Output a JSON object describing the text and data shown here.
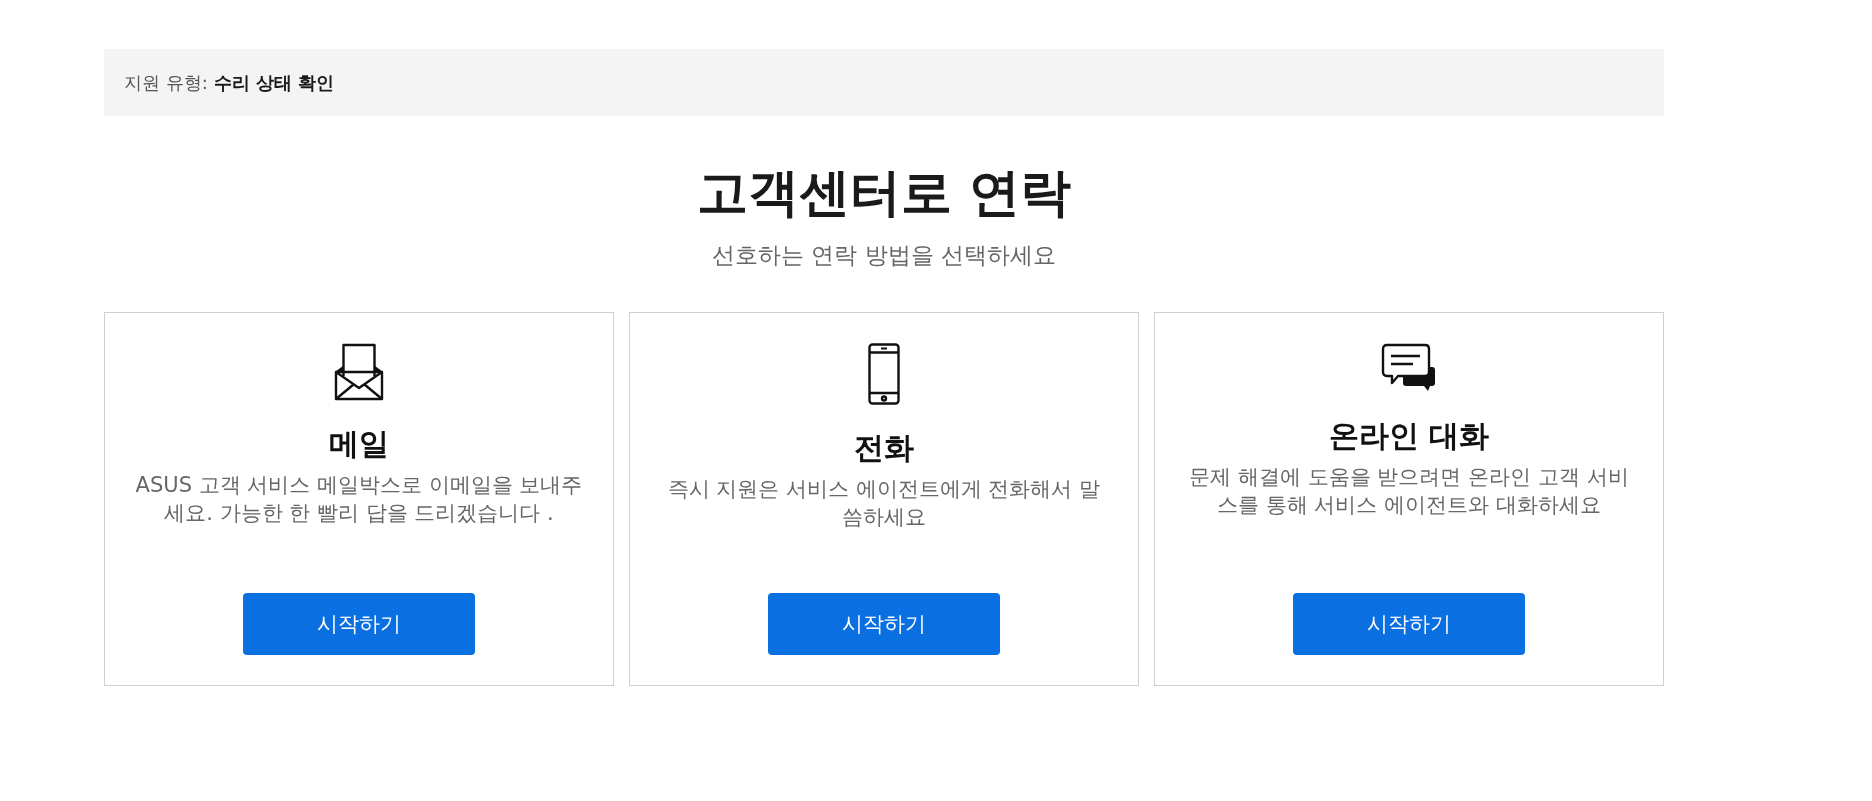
{
  "breadcrumb": {
    "text": "지원 유형: **수리 상태 확인**"
  },
  "heading": {
    "title": "고객센터로 연락",
    "subtitle": "선호하는 연락 방법을 선택하세요"
  },
  "cards": [
    {
      "kind": "email",
      "title": "메일",
      "description": "ASUS 고객 서비스 메일박스로 이메일을 보내주세요. 가능한 한 빨리 답을 드리겠습니다 .",
      "button": "시작하기"
    },
    {
      "kind": "phone",
      "title": "전화",
      "description": "즉시 지원은 서비스 에이전트에게 전화해서 말씀하세요",
      "button": "시작하기"
    },
    {
      "kind": "chat",
      "title": "온라인 대화",
      "description": "문제 해결에 도움을 받으려면 온라인 고객 서비스를 통해 서비스 에이전트와 대화하세요",
      "button": "시작하기"
    }
  ]
}
